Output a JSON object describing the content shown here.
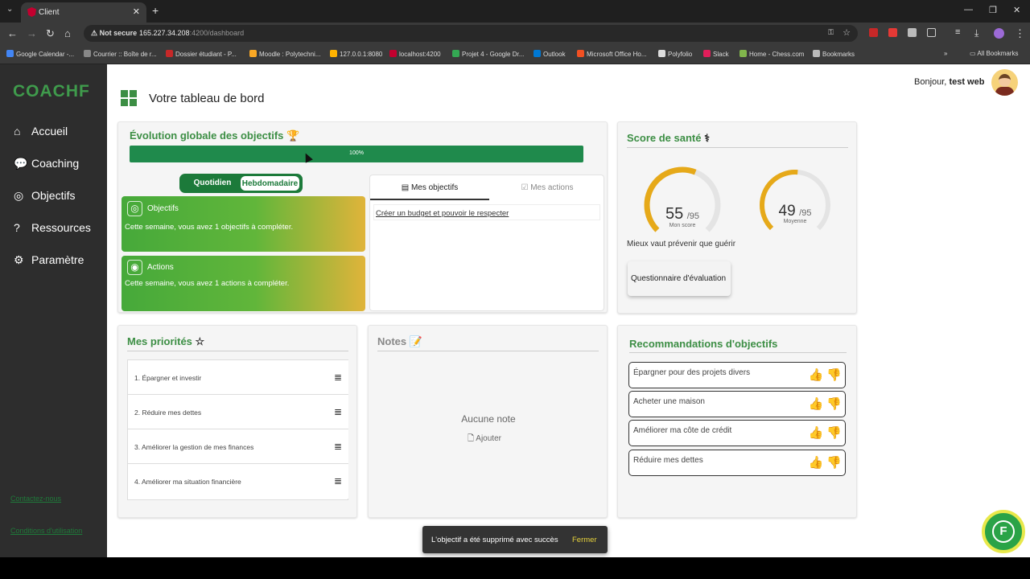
{
  "browser": {
    "tab_title": "Client",
    "url_warning": "Not secure",
    "url_host": "165.227.34.208",
    "url_path": ":4200/dashboard",
    "bookmarks": [
      {
        "label": "Google Calendar -...",
        "color": "#4285f4"
      },
      {
        "label": "Courrier :: Boîte de r...",
        "color": "#888"
      },
      {
        "label": "Dossier étudiant - P...",
        "color": "#c62828"
      },
      {
        "label": "Moodle : Polytechni...",
        "color": "#f9a825"
      },
      {
        "label": "127.0.0.1:8080",
        "color": "#ffb300"
      },
      {
        "label": "localhost:4200",
        "color": "#c3002f"
      },
      {
        "label": "Projet 4 - Google Dr...",
        "color": "#34a853"
      },
      {
        "label": "Outlook",
        "color": "#0078d4"
      },
      {
        "label": "Microsoft Office Ho...",
        "color": "#f25022"
      },
      {
        "label": "Polyfolio",
        "color": "#ddd"
      },
      {
        "label": "Slack",
        "color": "#e01e5a"
      },
      {
        "label": "Home - Chess.com",
        "color": "#81b64c"
      },
      {
        "label": "Bookmarks",
        "color": "#bbb"
      }
    ],
    "all_bookmarks": "All Bookmarks"
  },
  "sidebar": {
    "logo": "COACHF",
    "items": [
      "Accueil",
      "Coaching",
      "Objectifs",
      "Ressources",
      "Paramètre"
    ],
    "footer_links": [
      "Contactez-nous",
      "Conditions d'utilisation"
    ]
  },
  "header": {
    "title": "Votre tableau de bord",
    "greeting": "Bonjour,",
    "user": "test web"
  },
  "progress": {
    "title": "Évolution globale des objectifs",
    "label": "100%",
    "value": 1.0
  },
  "toggle": {
    "options": [
      "Quotidien",
      "Hebdomadaire"
    ],
    "selected": "Hebdomadaire"
  },
  "summary": {
    "objectifs_title": "Objectifs",
    "objectifs_text": "Cette semaine, vous avez 1 objectifs à compléter.",
    "actions_title": "Actions",
    "actions_text": "Cette semaine, vous avez 1 actions à compléter."
  },
  "tabs": {
    "items": [
      "Mes objectifs",
      "Mes actions"
    ],
    "active": "Mes objectifs",
    "objective_item": "Créer un budget et pouvoir le respecter"
  },
  "health": {
    "title": "Score de santé",
    "my_score": "55",
    "my_max": "/95",
    "my_label": "Mon score",
    "my_fraction": 0.579,
    "avg_score": "49",
    "avg_max": "/95",
    "avg_label": "Moyenne",
    "avg_fraction": 0.516,
    "motto": "Mieux vaut prévenir que guérir",
    "button": "Questionnaire d'évaluation",
    "accent": "#e6a919"
  },
  "priorities": {
    "title": "Mes priorités",
    "items": [
      "1. Épargner et investir",
      "2. Réduire mes dettes",
      "3. Améliorer la gestion de mes finances",
      "4. Améliorer ma situation financière"
    ]
  },
  "notes": {
    "title": "Notes",
    "empty": "Aucune note",
    "add": "Ajouter"
  },
  "recommendations": {
    "title": "Recommandations d'objectifs",
    "items": [
      "Épargner pour des projets divers",
      "Acheter une maison",
      "Améliorer ma côte de crédit",
      "Réduire mes dettes"
    ]
  },
  "toast": {
    "message": "L'objectif a été supprimé avec succès",
    "action": "Fermer"
  },
  "fab_letter": "F",
  "colors": {
    "brand": "#3c8e44",
    "progress": "#1f8a4c",
    "sidebar": "#2d2d2d"
  }
}
